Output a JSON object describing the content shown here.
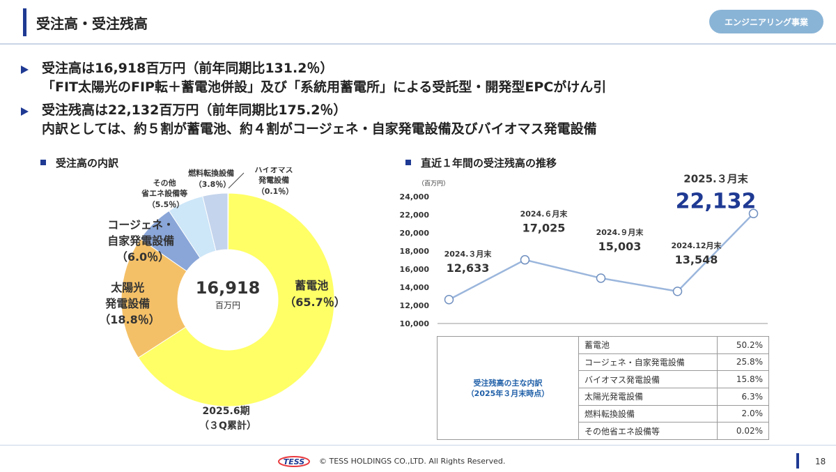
{
  "header": {
    "title": "受注高・受注残高",
    "badge": "エンジニアリング事業"
  },
  "bullets": [
    {
      "line1": "受注高は16,918百万円（前年同期比131.2％）",
      "line2": "「FIT太陽光のFIP転＋蓄電池併設」及び「系統用蓄電所」による受託型・開発型EPCがけん引"
    },
    {
      "line1": "受注残高は22,132百万円（前年同期比175.2％）",
      "line2": "内訳としては、約５割が蓄電池、約４割がコージェネ・自家発電設備及びバイオマス発電設備"
    }
  ],
  "donut": {
    "heading": "受注高の内訳",
    "center_value": "16,918",
    "center_unit": "百万円",
    "period_line1": "2025.6期",
    "period_line2": "（３Q累計）",
    "labels": {
      "battery": [
        "蓄電池",
        "（65.7％）"
      ],
      "solar": [
        "太陽光",
        "発電設備",
        "（18.8％）"
      ],
      "cogen": [
        "コージェネ・",
        "自家発電設備",
        "（6.0％）"
      ],
      "other": [
        "その他",
        "省エネ設備等",
        "（5.5％）"
      ],
      "fuel": [
        "燃料転換設備",
        "（3.8％）"
      ],
      "biomass": [
        "バイオマス",
        "発電設備",
        "（0.1％）"
      ]
    }
  },
  "line_chart": {
    "heading": "直近１年間の受注残高の推移",
    "latest_label": "2025.３月末",
    "latest_value": "22,132"
  },
  "table": {
    "side_line1": "受注残高の主な内訳",
    "side_line2": "（2025年３月末時点）",
    "rows": [
      {
        "name": "蓄電池",
        "value": "50.2%"
      },
      {
        "name": "コージェネ・自家発電設備",
        "value": "25.8%"
      },
      {
        "name": "バイオマス発電設備",
        "value": "15.8%"
      },
      {
        "name": "太陽光発電設備",
        "value": "6.3%"
      },
      {
        "name": "燃料転換設備",
        "value": "2.0%"
      },
      {
        "name": "その他省エネ設備等",
        "value": "0.02%"
      }
    ]
  },
  "footer": {
    "logo": "TESS",
    "copyright": "© TESS HOLDINGS CO.,LTD. All Rights Reserved.",
    "page": "18"
  },
  "chart_data": [
    {
      "type": "pie",
      "title": "受注高の内訳",
      "categories": [
        "バイオマス発電設備",
        "蓄電池",
        "太陽光発電設備",
        "コージェネ・自家発電設備",
        "その他省エネ設備等",
        "燃料転換設備"
      ],
      "values": [
        0.1,
        65.7,
        18.8,
        6.0,
        5.5,
        3.8
      ],
      "colors": [
        "#eeeeee",
        "#ffff66",
        "#f4c067",
        "#8aa6d8",
        "#cde6f8",
        "#c4d4ec"
      ],
      "donut": true
    },
    {
      "type": "line",
      "title": "直近１年間の受注残高の推移",
      "ylabel": "（百万円）",
      "categories": [
        "2024.３月末",
        "2024.６月末",
        "2024.９月末",
        "2024.12月末",
        "2025.３月末"
      ],
      "values": [
        12633,
        17025,
        15003,
        13548,
        22132
      ],
      "value_labels": [
        "12,633",
        "17,025",
        "15,003",
        "13,548",
        "22,132"
      ],
      "ylim": [
        10000,
        24000
      ],
      "yticks": [
        10000,
        12000,
        14000,
        16000,
        18000,
        20000,
        22000,
        24000
      ],
      "ytick_labels": [
        "10,000",
        "12,000",
        "14,000",
        "16,000",
        "18,000",
        "20,000",
        "22,000",
        "24,000"
      ],
      "line_color": "#9bb6dc"
    }
  ]
}
